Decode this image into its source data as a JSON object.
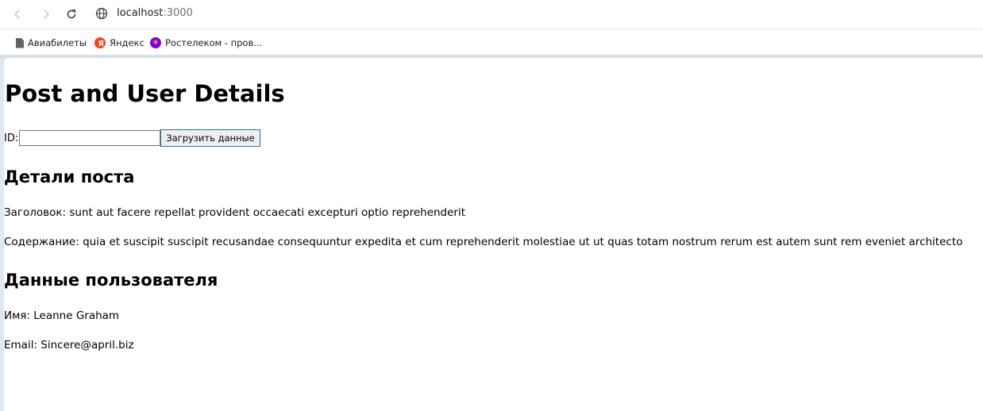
{
  "browser": {
    "url_host": "localhost",
    "url_port": ":3000",
    "bookmarks": [
      {
        "label": "Авиабилеты",
        "icon": "document-icon"
      },
      {
        "label": "Яндекс",
        "icon": "yandex-icon",
        "color": "#fc3f1d"
      },
      {
        "label": "Ростелеком - пров...",
        "icon": "rostelecom-icon",
        "color": "#7700ff"
      }
    ]
  },
  "page": {
    "title": "Post and User Details",
    "id_label": "ID:",
    "id_value": "",
    "load_button": "Загрузить данные",
    "post_heading": "Детали поста",
    "post_title": "Заголовок: sunt aut facere repellat provident occaecati excepturi optio reprehenderit",
    "post_body": "Содержание: quia et suscipit suscipit recusandae consequuntur expedita et cum reprehenderit molestiae ut ut quas totam nostrum rerum est autem sunt rem eveniet architecto",
    "user_heading": "Данные пользователя",
    "user_name": "Имя: Leanne Graham",
    "user_email": "Email: Sincere@april.biz"
  }
}
